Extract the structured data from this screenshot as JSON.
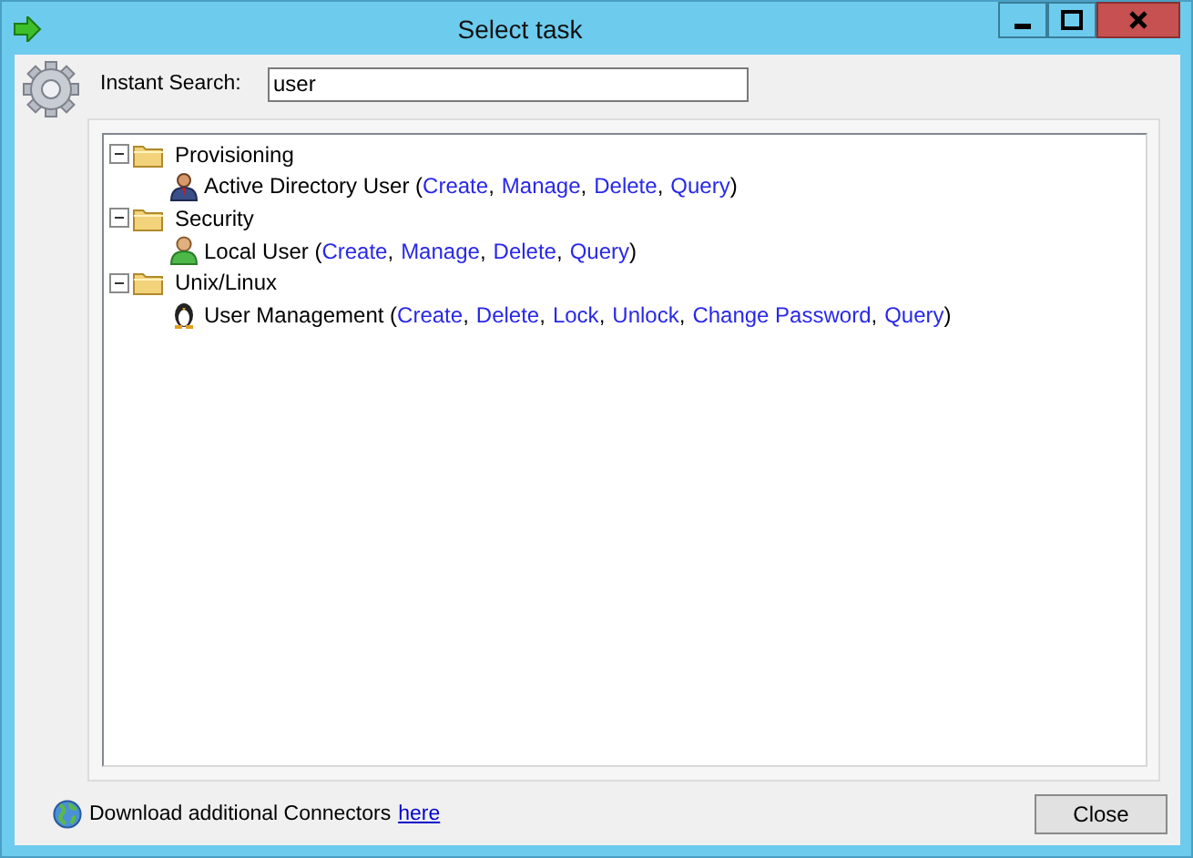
{
  "window": {
    "title": "Select task"
  },
  "search": {
    "label": "Instant Search:",
    "value": "user"
  },
  "tree": [
    {
      "label": "Provisioning",
      "expanded": true,
      "children": [
        {
          "kind": "ad-user",
          "name": "Active Directory User (",
          "actions": [
            {
              "label": "Create",
              "after": ","
            },
            {
              "label": "Manage",
              "after": ","
            },
            {
              "label": "Delete",
              "after": ","
            },
            {
              "label": "Query",
              "after": ")"
            }
          ]
        }
      ]
    },
    {
      "label": "Security",
      "expanded": true,
      "children": [
        {
          "kind": "local-user",
          "name": "Local User (",
          "actions": [
            {
              "label": "Create",
              "after": ","
            },
            {
              "label": "Manage",
              "after": ","
            },
            {
              "label": "Delete",
              "after": ","
            },
            {
              "label": "Query",
              "after": ")"
            }
          ]
        }
      ]
    },
    {
      "label": "Unix/Linux",
      "expanded": true,
      "children": [
        {
          "kind": "linux",
          "name": "User Management (",
          "actions": [
            {
              "label": "Create",
              "after": ","
            },
            {
              "label": "Delete",
              "after": ","
            },
            {
              "label": "Lock",
              "after": ","
            },
            {
              "label": "Unlock",
              "after": ","
            },
            {
              "label": "Change Password",
              "after": ","
            },
            {
              "label": "Query",
              "after": ")"
            }
          ]
        }
      ]
    }
  ],
  "footer": {
    "text": "Download additional Connectors",
    "link": "here"
  },
  "buttons": [
    "Close"
  ]
}
